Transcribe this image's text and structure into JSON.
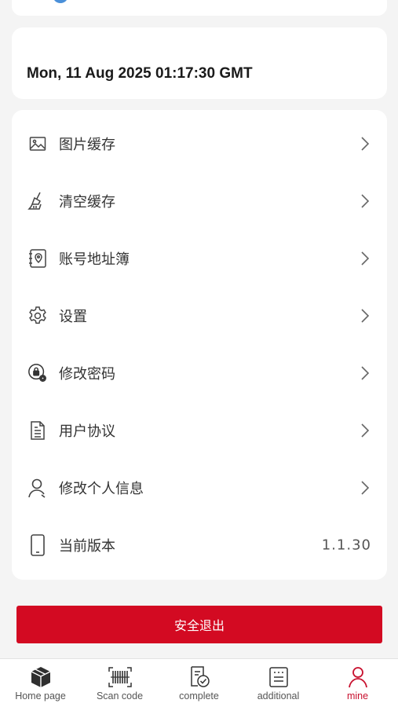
{
  "date_card": {
    "text": "Mon, 11 Aug 2025 01:17:30 GMT"
  },
  "menu": [
    {
      "label": "图片缓存",
      "icon": "image-icon"
    },
    {
      "label": "清空缓存",
      "icon": "broom-icon"
    },
    {
      "label": "账号地址簿",
      "icon": "address-book-icon"
    },
    {
      "label": "设置",
      "icon": "gear-icon"
    },
    {
      "label": "修改密码",
      "icon": "lock-gear-icon"
    },
    {
      "label": "用户协议",
      "icon": "document-icon"
    },
    {
      "label": "修改个人信息",
      "icon": "user-icon"
    },
    {
      "label": "当前版本",
      "icon": "phone-icon",
      "value": "1.1.30"
    }
  ],
  "logout": {
    "label": "安全退出"
  },
  "tabbar": [
    {
      "label": "Home page",
      "icon": "package-icon"
    },
    {
      "label": "Scan code",
      "icon": "barcode-icon"
    },
    {
      "label": "complete",
      "icon": "check-doc-icon"
    },
    {
      "label": "additional",
      "icon": "list-doc-icon"
    },
    {
      "label": "mine",
      "icon": "person-icon",
      "active": true
    }
  ],
  "colors": {
    "accent": "#d30a22",
    "active_tab": "#c8102e",
    "background": "#f4f4f4"
  }
}
